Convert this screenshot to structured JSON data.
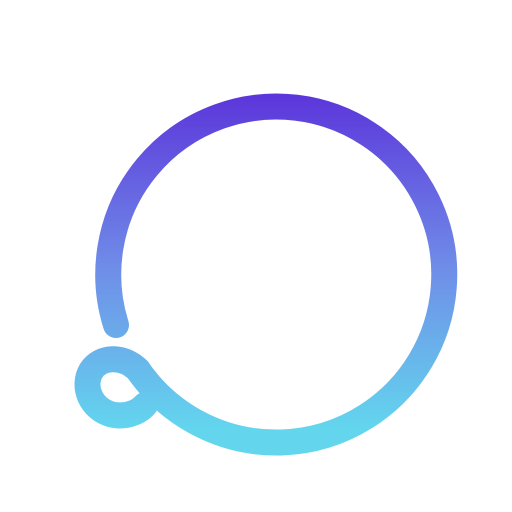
{
  "icon": {
    "name": "ring-chat-bubble-logo",
    "colors": {
      "background": "#FFFFFF",
      "gradient_top": "#5A2BD9",
      "gradient_middle": "#6F8EE8",
      "gradient_bottom": "#63D6EE"
    }
  }
}
